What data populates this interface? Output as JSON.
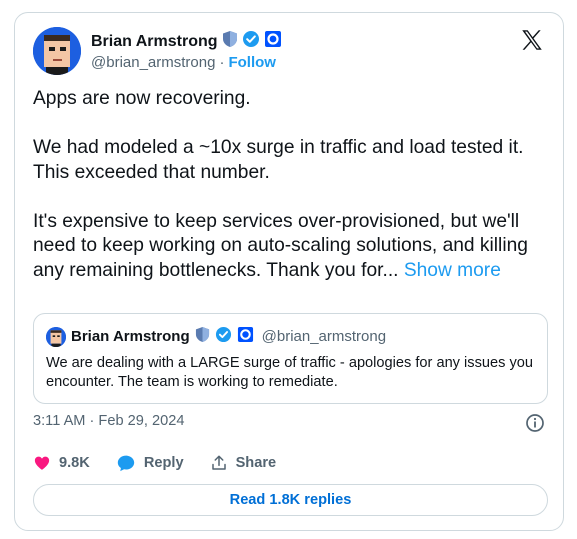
{
  "author": {
    "name": "Brian Armstrong",
    "handle": "@brian_armstrong",
    "separator": "·",
    "follow_label": "Follow"
  },
  "tweet": {
    "paragraphs": [
      "Apps are now recovering.",
      "We had modeled a ~10x surge in traffic and load tested it. This exceeded that number.",
      "It's expensive to keep services over-provisioned, but we'll need to keep working on auto-scaling solutions, and killing any remaining bottlenecks. Thank you for..."
    ],
    "show_more_label": "Show more"
  },
  "quote": {
    "name": "Brian Armstrong",
    "handle": "@brian_armstrong",
    "text": "We are dealing with a LARGE surge of traffic - apologies for any issues you encounter. The team is working to remediate."
  },
  "meta": {
    "timestamp": "3:11 AM · Feb 29, 2024"
  },
  "actions": {
    "likes": "9.8K",
    "reply_label": "Reply",
    "share_label": "Share"
  },
  "replies_button": "Read 1.8K replies",
  "colors": {
    "accent": "#1d9bf0",
    "like": "#f91880",
    "verified": "#1d9bf0",
    "org_badge": "#0052ff"
  },
  "icons": [
    "avatar",
    "government-shield-icon",
    "verified-check-icon",
    "coinbase-badge-icon",
    "x-logo-icon",
    "info-icon",
    "heart-icon",
    "reply-icon",
    "share-icon"
  ]
}
